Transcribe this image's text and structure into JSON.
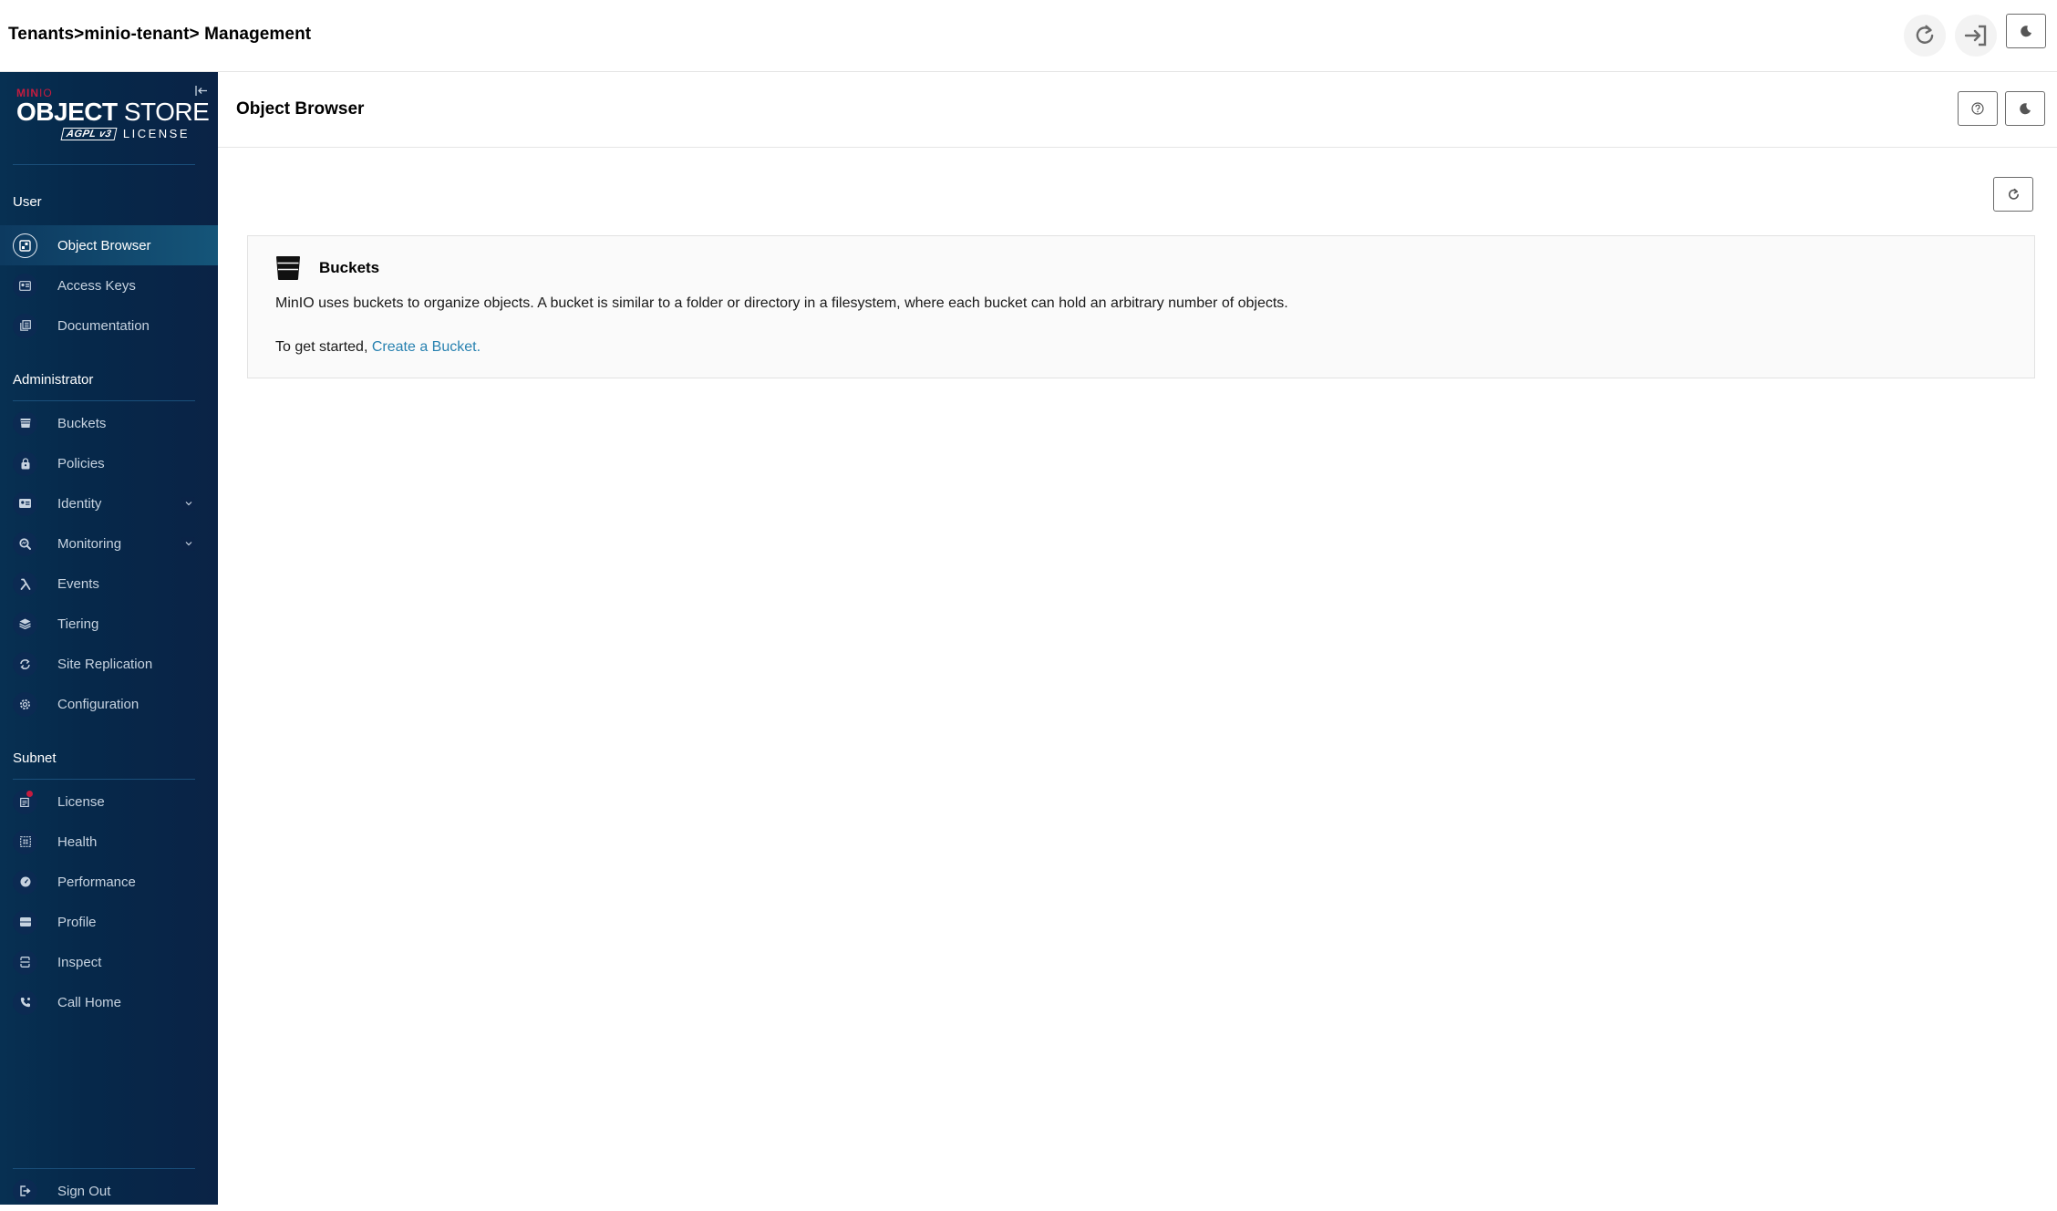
{
  "topbar": {
    "breadcrumb": "Tenants>minio-tenant> Management",
    "buttons": {
      "refresh_icon": "refresh-icon",
      "logout_icon": "logout-icon",
      "theme_icon": "moon-icon"
    }
  },
  "sidebar": {
    "logo": {
      "brand_bold": "MIN",
      "brand_light": "IO",
      "product_bold": "OBJECT",
      "product_light": " STORE",
      "agpl": "AGPL v3",
      "license": "LICENSE"
    },
    "sections": {
      "user": {
        "label": "User",
        "items": [
          {
            "label": "Object Browser",
            "icon": "object-browser-icon",
            "active": true
          },
          {
            "label": "Access Keys",
            "icon": "access-keys-icon"
          },
          {
            "label": "Documentation",
            "icon": "documentation-icon"
          }
        ]
      },
      "administrator": {
        "label": "Administrator",
        "items": [
          {
            "label": "Buckets",
            "icon": "bucket-icon"
          },
          {
            "label": "Policies",
            "icon": "policy-lock-icon"
          },
          {
            "label": "Identity",
            "icon": "identity-card-icon",
            "expandable": true
          },
          {
            "label": "Monitoring",
            "icon": "monitoring-icon",
            "expandable": true
          },
          {
            "label": "Events",
            "icon": "lambda-icon"
          },
          {
            "label": "Tiering",
            "icon": "tiers-icon"
          },
          {
            "label": "Site Replication",
            "icon": "replication-icon"
          },
          {
            "label": "Configuration",
            "icon": "gear-icon"
          }
        ]
      },
      "subnet": {
        "label": "Subnet",
        "items": [
          {
            "label": "License",
            "icon": "license-icon",
            "badge": true
          },
          {
            "label": "Health",
            "icon": "health-icon"
          },
          {
            "label": "Performance",
            "icon": "speedometer-icon"
          },
          {
            "label": "Profile",
            "icon": "profile-icon"
          },
          {
            "label": "Inspect",
            "icon": "inspect-icon"
          },
          {
            "label": "Call Home",
            "icon": "phone-icon"
          }
        ]
      }
    },
    "sign_out": "Sign Out"
  },
  "main": {
    "title": "Object Browser",
    "card": {
      "title": "Buckets",
      "description": "MinIO uses buckets to organize objects. A bucket is similar to a folder or directory in a filesystem, where each bucket can hold an arbitrary number of objects.",
      "cta_prefix": "To get started, ",
      "cta_link": "Create a Bucket."
    }
  }
}
